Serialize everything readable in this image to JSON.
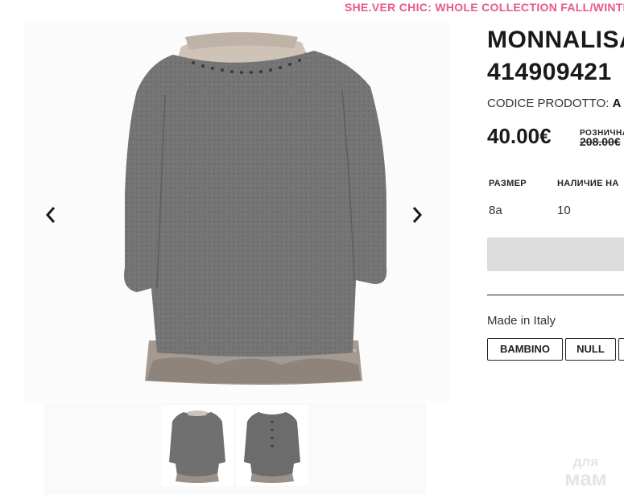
{
  "banner": {
    "text": "SHE.VER CHIC: WHOLE COLLECTION FALL/WINTER"
  },
  "gallery": {
    "prev_icon": "chevron-left-icon",
    "next_icon": "chevron-right-icon",
    "thumbnails": [
      "front view",
      "back view"
    ]
  },
  "product": {
    "title_line1": "MONNALISA",
    "title_line2": "414909421",
    "code_label": "CODICE PRODOTTO:",
    "code_value": "A",
    "price": "40.00€",
    "retail_label": "РОЗНИЧНАЯ",
    "retail_price": "208.00€",
    "table": {
      "headers": [
        "РАЗМЕР",
        "НАЛИЧИЕ НА"
      ],
      "rows": [
        [
          "8a",
          "10"
        ]
      ]
    },
    "made_in": "Made in Italy",
    "tags": [
      "BAMBINO",
      "NULL",
      ""
    ]
  },
  "watermark": {
    "line1": "для",
    "line2": "мам"
  },
  "colors": {
    "accent": "#e8578c",
    "button_disabled": "#dddddd"
  }
}
